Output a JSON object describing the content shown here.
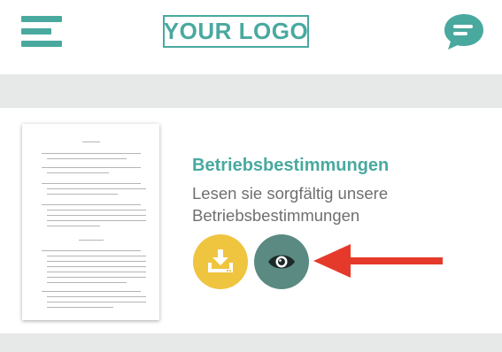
{
  "header": {
    "logo_text": "YOUR LOGO",
    "menu_icon": "hamburger-menu-icon",
    "chat_icon": "chat-bubble-icon"
  },
  "document": {
    "title": "Betriebsbestimmungen",
    "description": "Lesen sie sorgfältig unsere Betriebsbestimmungen",
    "thumbnail_icon": "document-preview",
    "actions": [
      {
        "id": "download",
        "icon": "download-icon",
        "color": "#efc43f"
      },
      {
        "id": "view",
        "icon": "eye-icon",
        "color": "#5a8a82"
      }
    ]
  },
  "annotation": {
    "icon": "red-arrow-pointer",
    "color": "#e53a2b"
  },
  "colors": {
    "accent": "#49a99f",
    "band": "#e6e9e8",
    "text_secondary": "#6f6f6f"
  }
}
